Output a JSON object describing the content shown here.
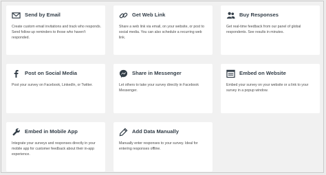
{
  "cards": [
    {
      "title": "Send by Email",
      "icon": "email-icon",
      "desc": "Create custom email invitations and track who responds. Send follow up reminders to those who haven't responded."
    },
    {
      "title": "Get Web Link",
      "icon": "link-icon",
      "desc": "Share a web link via email, on your website, or post to social media. You can also schedule a recurring web link."
    },
    {
      "title": "Buy Responses",
      "icon": "people-icon",
      "desc": "Get real-time feedback from our panel of global respondents. See results in minutes."
    },
    {
      "title": "Post on Social Media",
      "icon": "facebook-icon",
      "desc": "Post your survey on Facebook, LinkedIn, or Twitter."
    },
    {
      "title": "Share in Messenger",
      "icon": "messenger-icon",
      "desc": "Let others to take your survey directly in Facebook Messenger."
    },
    {
      "title": "Embed on Website",
      "icon": "embed-icon",
      "desc": "Embed your survey on your website or a link to your survey in a popup window."
    },
    {
      "title": "Embed in Mobile App",
      "icon": "wrench-icon",
      "desc": "Integrate your surveys and responses directly in your mobile app for customer feedback about their in-app experience."
    },
    {
      "title": "Add Data Manually",
      "icon": "pencil-icon",
      "desc": "Manually enter responses to your survey. Ideal for entering responses offline."
    }
  ]
}
